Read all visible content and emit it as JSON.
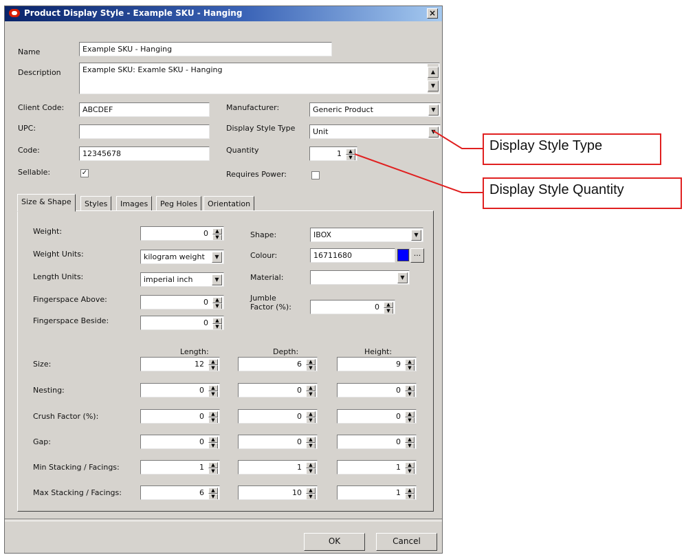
{
  "window": {
    "title": "Product Display Style - Example SKU - Hanging",
    "close": "×"
  },
  "fields": {
    "name_label": "Name",
    "name_value": "Example SKU - Hanging",
    "description_label": "Description",
    "description_value": "Example SKU: Examle SKU - Hanging",
    "client_code_label": "Client Code:",
    "client_code_value": "ABCDEF",
    "upc_label": "UPC:",
    "upc_value": "",
    "code_label": "Code:",
    "code_value": "12345678",
    "sellable_label": "Sellable:",
    "sellable_checked": "✓",
    "manufacturer_label": "Manufacturer:",
    "manufacturer_value": "Generic Product",
    "display_style_type_label": "Display Style Type",
    "display_style_type_value": "Unit",
    "quantity_label": "Quantity",
    "quantity_value": "1",
    "requires_power_label": "Requires Power:",
    "requires_power_checked": ""
  },
  "tabs": [
    {
      "label": "Size & Shape",
      "active": true
    },
    {
      "label": "Styles"
    },
    {
      "label": "Images"
    },
    {
      "label": "Peg Holes"
    },
    {
      "label": "Orientation"
    }
  ],
  "size_shape": {
    "weight_label": "Weight:",
    "weight_value": "0",
    "weight_units_label": "Weight Units:",
    "weight_units_value": "kilogram weight",
    "length_units_label": "Length Units:",
    "length_units_value": "imperial inch",
    "fingerspace_above_label": "Fingerspace Above:",
    "fingerspace_above_value": "0",
    "fingerspace_beside_label": "Fingerspace Beside:",
    "fingerspace_beside_value": "0",
    "shape_label": "Shape:",
    "shape_value": "IBOX",
    "colour_label": "Colour:",
    "colour_value": "16711680",
    "colour_swatch": "#0000ff",
    "colour_browse": "...",
    "material_label": "Material:",
    "material_value": "",
    "jumble_label_1": "Jumble",
    "jumble_label_2": "Factor (%):",
    "jumble_value": "0"
  },
  "dimensions": {
    "columns": [
      "Length:",
      "Depth:",
      "Height:"
    ],
    "rows": [
      {
        "label": "Size:",
        "values": [
          "12",
          "6",
          "9"
        ]
      },
      {
        "label": "Nesting:",
        "values": [
          "0",
          "0",
          "0"
        ]
      },
      {
        "label": "Crush Factor (%):",
        "values": [
          "0",
          "0",
          "0"
        ]
      },
      {
        "label": "Gap:",
        "values": [
          "0",
          "0",
          "0"
        ]
      },
      {
        "label": "Min Stacking / Facings:",
        "values": [
          "1",
          "1",
          "1"
        ]
      },
      {
        "label": "Max Stacking / Facings:",
        "values": [
          "6",
          "10",
          "1"
        ]
      }
    ]
  },
  "buttons": {
    "ok": "OK",
    "cancel": "Cancel"
  },
  "callouts": {
    "display_style_type": "Display Style Type",
    "display_style_quantity": "Display Style Quantity"
  },
  "colors": {
    "callout_red": "#e02020",
    "dialog_face": "#d6d3ce"
  }
}
